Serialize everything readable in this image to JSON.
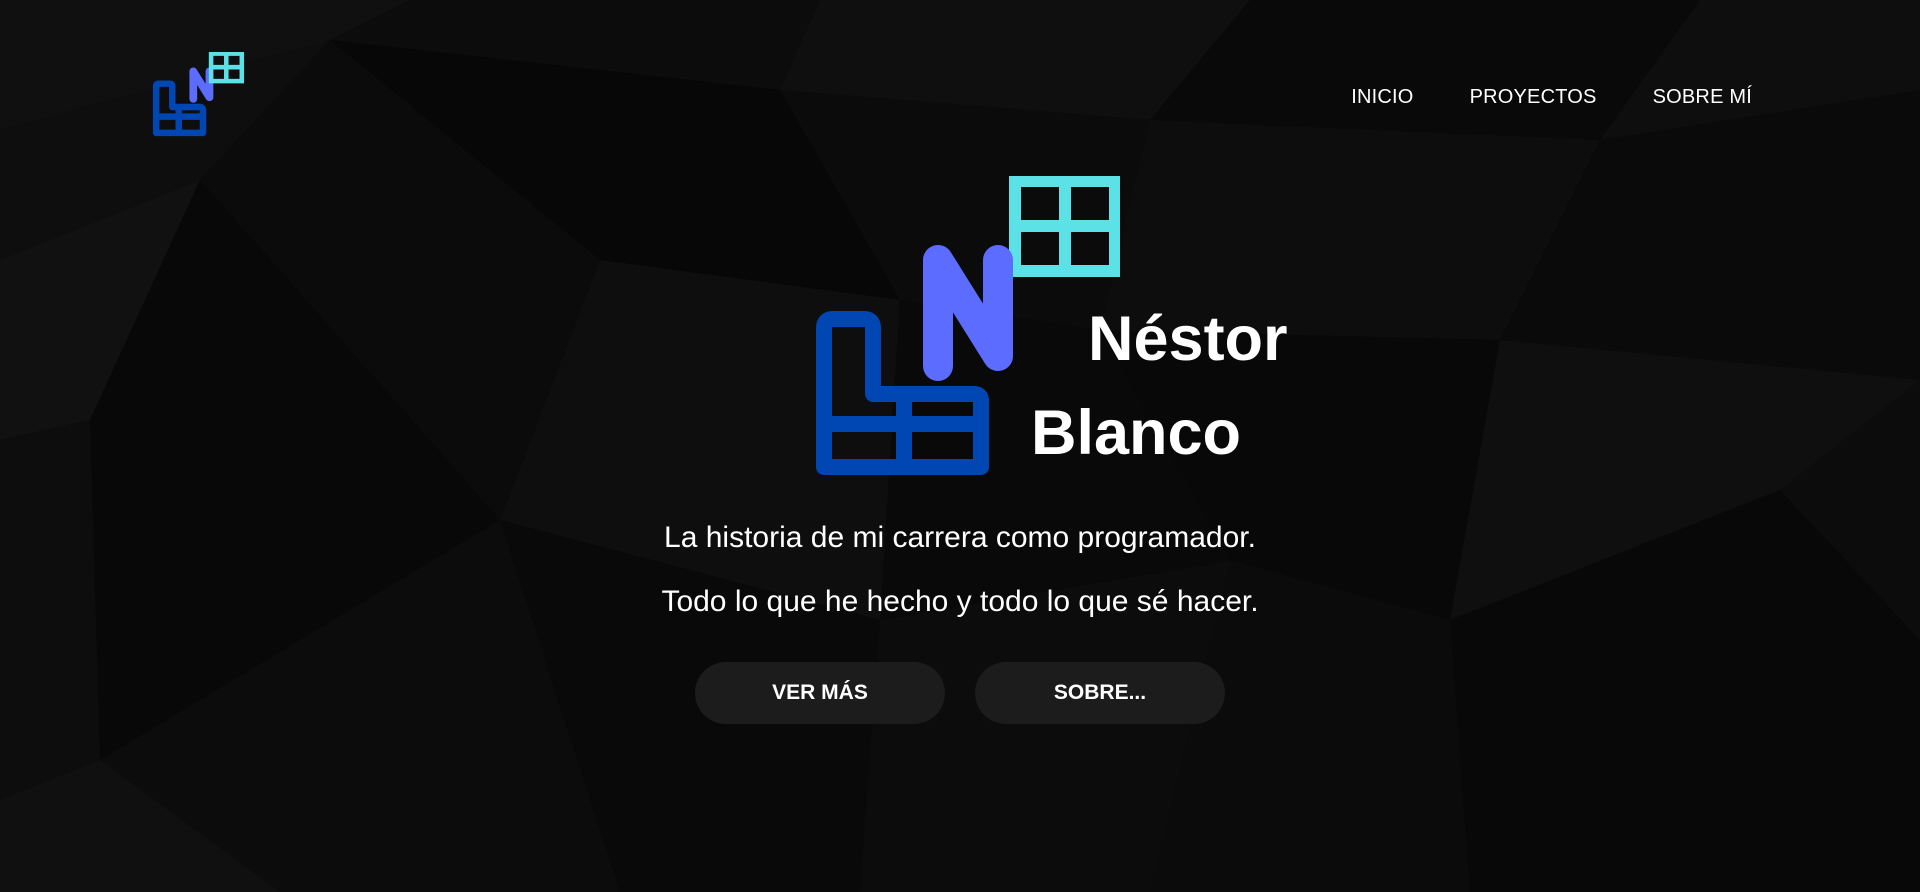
{
  "nav": {
    "items": [
      {
        "label": "INICIO"
      },
      {
        "label": "PROYECTOS"
      },
      {
        "label": "SOBRE MÍ"
      }
    ]
  },
  "hero": {
    "first_name": "Néstor",
    "last_name": "Blanco",
    "tagline_1": "La historia de mi carrera como programador.",
    "tagline_2": "Todo lo que he hecho y todo lo que sé hacer.",
    "button_more": "VER MÁS",
    "button_about": "SOBRE..."
  },
  "logo": {
    "letter": "N",
    "colors": {
      "dark_blue": "#0047b3",
      "mid_blue": "#5b6cff",
      "cyan": "#5ce1e6"
    }
  },
  "theme": {
    "background": "#0a0a0a",
    "button_bg": "#1c1c1c",
    "text": "#ffffff"
  }
}
